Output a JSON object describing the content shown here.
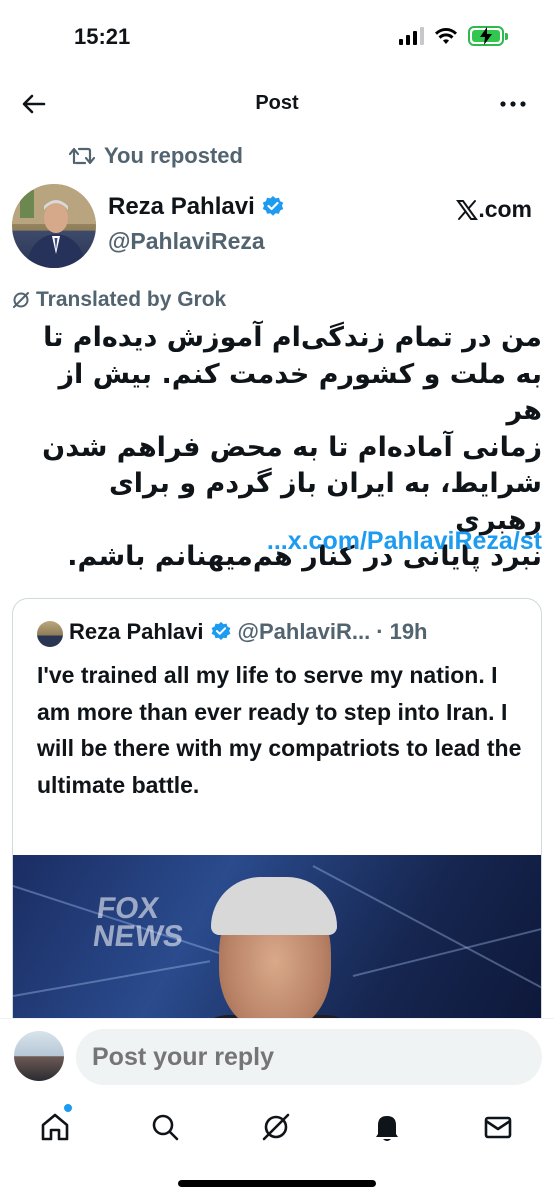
{
  "status_bar": {
    "time": "15:21",
    "battery_color": "#31c74f"
  },
  "header": {
    "title": "Post",
    "back_icon": "arrow-left-icon",
    "more_icon": "more-icon"
  },
  "repost": {
    "label": "You reposted"
  },
  "author": {
    "name": "Reza Pahlavi",
    "handle": "@PahlaviReza",
    "verified_color": "#1d9bf0"
  },
  "source": {
    "label": ".com"
  },
  "translated": {
    "label": "Translated by Grok"
  },
  "post": {
    "lines": [
      "من در تمام زندگی‌ام آموزش دیده‌ام تا",
      "به ملت و کشورم خدمت کنم. بیش از هر",
      "زمانی آماده‌ام تا به محض فراهم شدن",
      "شرایط، به ایران باز گردم و برای رهبری",
      "نبرد پایانی در کنار هم‌میهنانم باشم."
    ],
    "link": "...x.com/PahlaviReza/st"
  },
  "quote": {
    "name": "Reza Pahlavi",
    "handle": "@PahlaviR...",
    "separator": "·",
    "time": "19h",
    "text": "I've trained all my life to serve my nation. I am more than ever ready to step into Iran. I will be there with my compatriots to lead the ultimate battle.",
    "media_logo_line1": "FOX",
    "media_logo_line2": "NEWS"
  },
  "reply": {
    "placeholder": "Post your reply"
  },
  "bottom_nav": {
    "items": [
      "home-icon",
      "search-icon",
      "grok-icon",
      "notifications-icon",
      "messages-icon"
    ]
  },
  "colors": {
    "accent": "#1d9bf0",
    "muted": "#536471",
    "text": "#0f1419"
  }
}
